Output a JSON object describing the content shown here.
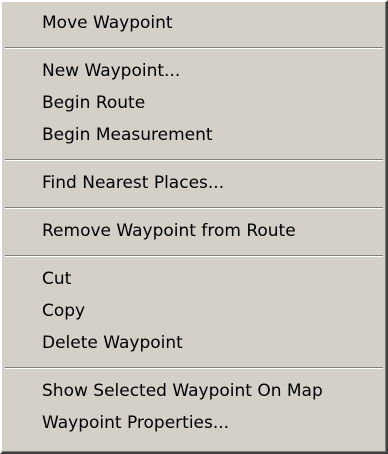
{
  "menu": {
    "groups": [
      {
        "items": [
          "Move Waypoint"
        ]
      },
      {
        "items": [
          "New Waypoint...",
          "Begin Route",
          "Begin Measurement"
        ]
      },
      {
        "items": [
          "Find Nearest Places..."
        ]
      },
      {
        "items": [
          "Remove Waypoint from Route"
        ]
      },
      {
        "items": [
          "Cut",
          "Copy",
          "Delete Waypoint"
        ]
      },
      {
        "items": [
          "Show Selected Waypoint On Map",
          "Waypoint Properties..."
        ]
      }
    ]
  }
}
